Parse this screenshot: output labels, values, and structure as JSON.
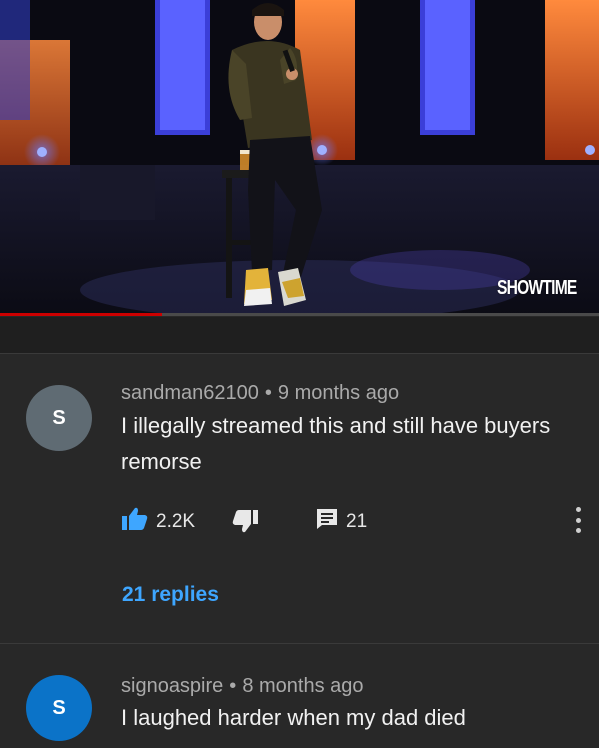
{
  "video": {
    "watermark": "SHOWTIME",
    "progress_fraction": 0.27
  },
  "comments": [
    {
      "avatar_letter": "S",
      "avatar_color": "#5f6b73",
      "author": "sandman62100",
      "separator": "•",
      "age": "9 months ago",
      "text_line1": "I illegally streamed this and still have buyers",
      "text_line2": "remorse",
      "likes": "2.2K",
      "reply_count": "21",
      "replies_link": "21 replies",
      "like_icon": "thumbs-up-icon",
      "dislike_icon": "thumbs-down-icon",
      "reply_icon": "comment-icon",
      "menu_icon": "more-vert-icon"
    },
    {
      "avatar_letter": "S",
      "avatar_color": "#0b73c8",
      "author": "signoaspire",
      "separator": "•",
      "age": "8 months ago",
      "text_line1": "I laughed harder when my dad died"
    }
  ],
  "colors": {
    "background": "#282828",
    "link": "#3ea6ff",
    "like_active": "#3ea6ff",
    "progress": "#cc0000"
  }
}
